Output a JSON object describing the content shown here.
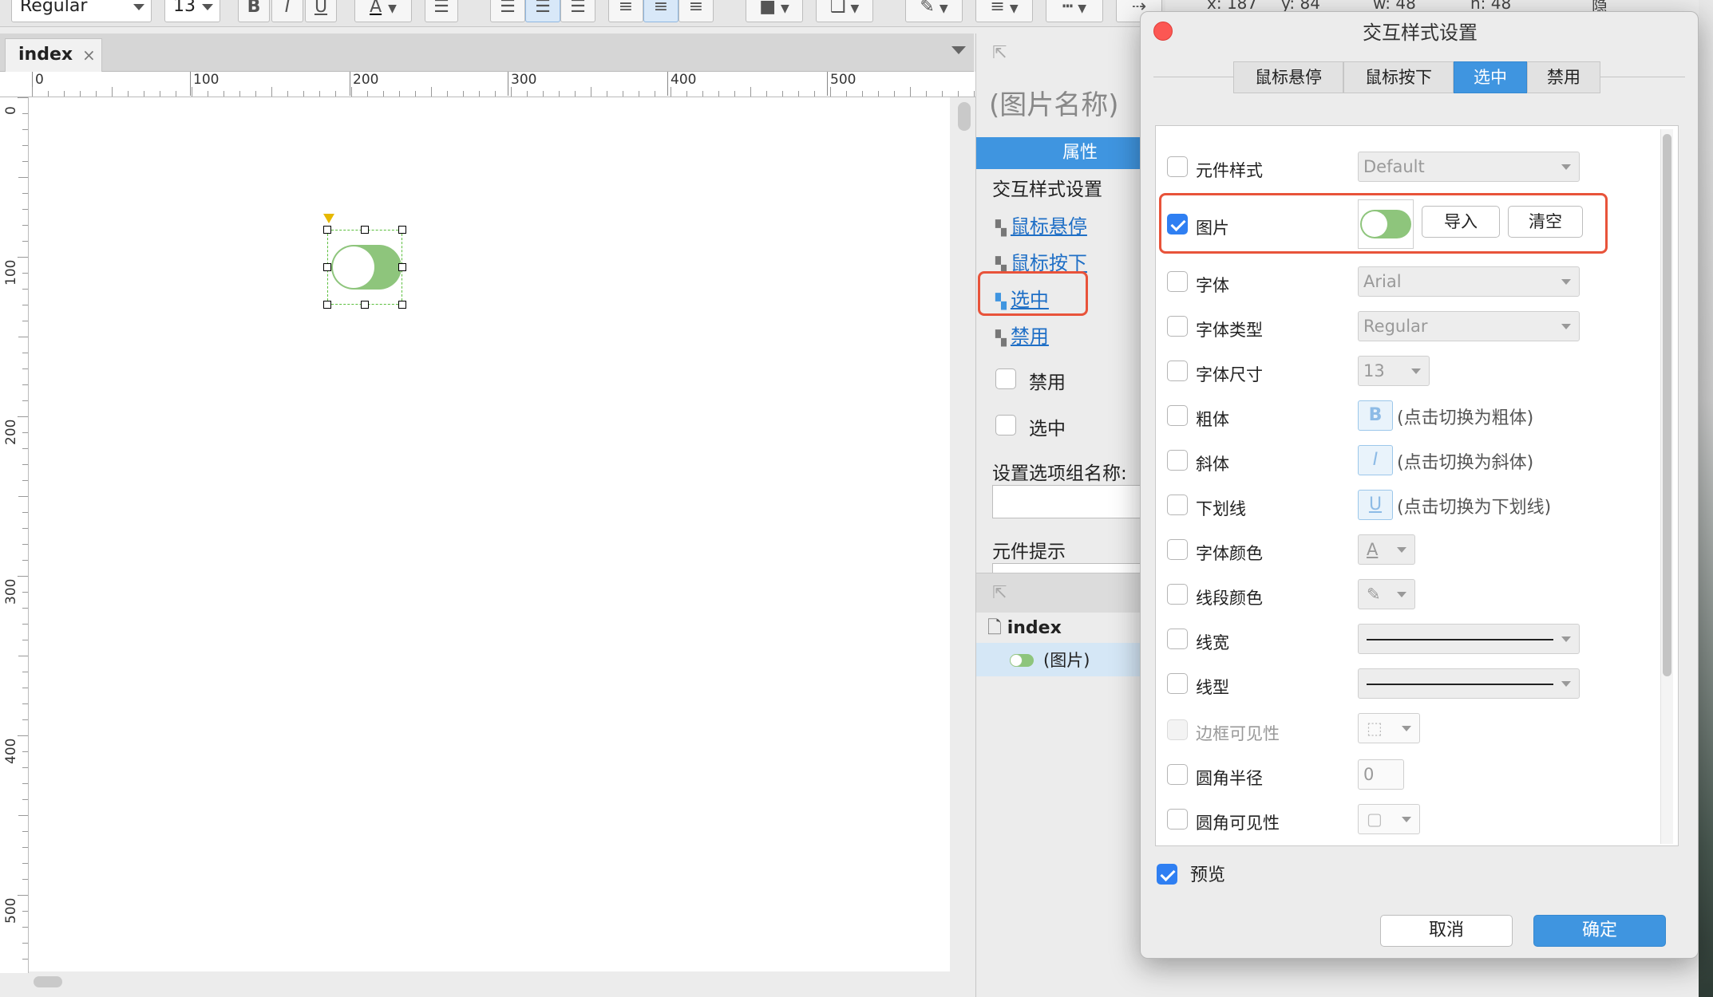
{
  "toolbar": {
    "font_style": "Regular",
    "font_size": "13",
    "bold": "B",
    "italic": "I",
    "underline": "U",
    "font_color": "A",
    "coords": {
      "x_label": "x:",
      "x_value": "187",
      "y_label": "y:",
      "y_value": "84",
      "w_label": "w:",
      "w_value": "48",
      "h_label": "h:",
      "h_value": "48"
    },
    "hide_label": "隐"
  },
  "page_tab": {
    "label": "index",
    "close": "×"
  },
  "ruler": {
    "h_labels": [
      "0",
      "100",
      "200",
      "300",
      "400",
      "500"
    ],
    "v_labels": [
      "0",
      "100",
      "200",
      "300",
      "400",
      "500"
    ]
  },
  "canvas": {
    "widget": {
      "type": "toggle",
      "on": true,
      "color": "#8ec57c"
    }
  },
  "side_panel": {
    "widget_name": "(图片名称)",
    "tab_label": "属性",
    "section_title": "交互样式设置",
    "links": [
      "鼠标悬停",
      "鼠标按下",
      "选中",
      "禁用"
    ],
    "checkbox_disabled": "禁用",
    "checkbox_selected": "选中",
    "group_label": "设置选项组名称:",
    "tooltip_label": "元件提示",
    "outline": {
      "page": "index",
      "item": "(图片)"
    }
  },
  "dialog": {
    "title": "交互样式设置",
    "tabs": [
      "鼠标悬停",
      "鼠标按下",
      "选中",
      "禁用"
    ],
    "active_tab": "选中",
    "rows": {
      "style": {
        "label": "元件样式",
        "value": "Default"
      },
      "image": {
        "label": "图片",
        "checked": true,
        "import": "导入",
        "clear": "清空"
      },
      "font": {
        "label": "字体",
        "value": "Arial"
      },
      "font_type": {
        "label": "字体类型",
        "value": "Regular"
      },
      "font_size": {
        "label": "字体尺寸",
        "value": "13"
      },
      "bold": {
        "label": "粗体",
        "btn": "B",
        "hint": "(点击切换为粗体)"
      },
      "italic": {
        "label": "斜体",
        "btn": "I",
        "hint": "(点击切换为斜体)"
      },
      "underline": {
        "label": "下划线",
        "btn": "U",
        "hint": "(点击切换为下划线)"
      },
      "font_color": {
        "label": "字体颜色",
        "btn": "A"
      },
      "line_color": {
        "label": "线段颜色"
      },
      "line_width": {
        "label": "线宽"
      },
      "line_style": {
        "label": "线型"
      },
      "border_visibility": {
        "label": "边框可见性"
      },
      "corner_radius": {
        "label": "圆角半径",
        "value": "0"
      },
      "corner_visibility": {
        "label": "圆角可见性"
      }
    },
    "preview": {
      "label": "预览",
      "checked": true
    },
    "cancel": "取消",
    "ok": "确定"
  },
  "colors": {
    "accent": "#3f95e0",
    "highlight": "#e8533a",
    "toggle_green": "#8ec57c",
    "link": "#1f6fc6"
  }
}
